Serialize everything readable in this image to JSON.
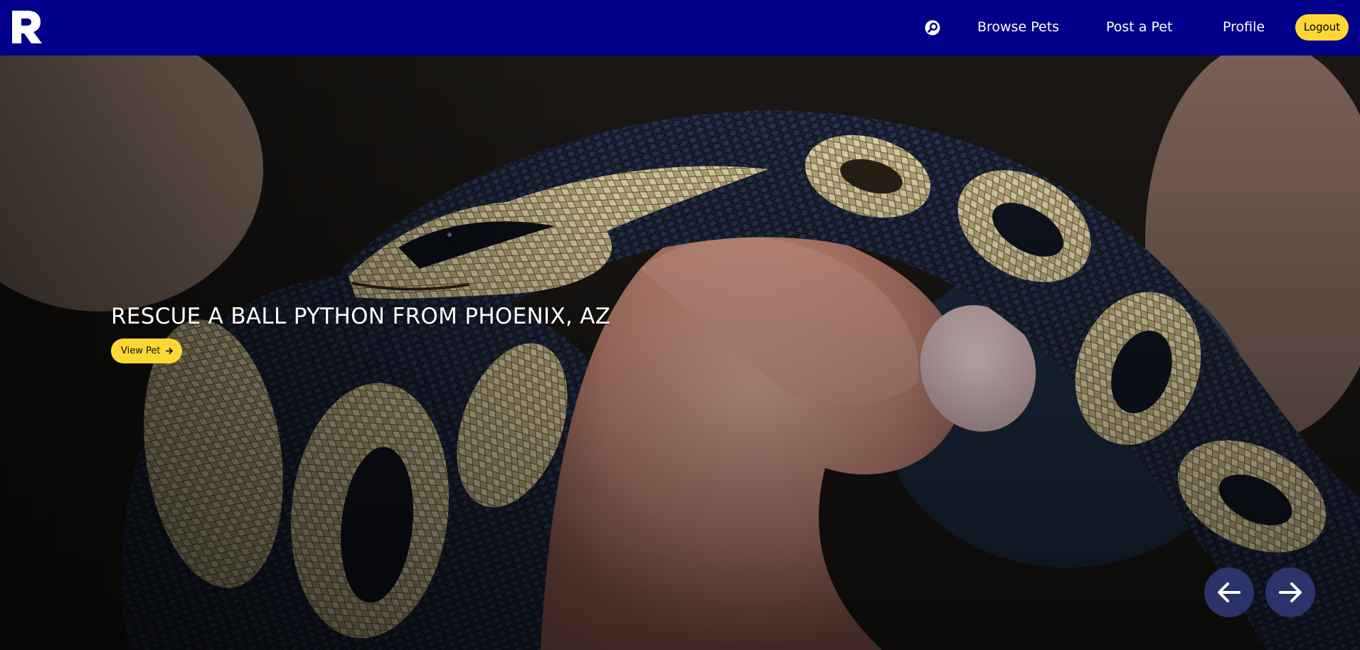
{
  "brand": {
    "logo_letter": "R",
    "colors": {
      "navbar": "#00008a",
      "accent": "#fdd835",
      "carousel_button": "#303a78"
    }
  },
  "nav": {
    "search_icon": "search-icon",
    "links": [
      "Browse Pets",
      "Post a Pet",
      "Profile"
    ],
    "logout_label": "Logout"
  },
  "hero": {
    "image_description": "ball-python-on-hand",
    "caption": "RESCUE A BALL PYTHON FROM PHOENIX, AZ",
    "cta_label": "View Pet",
    "cta_icon": "arrow-right-icon",
    "prev_icon": "arrow-left-icon",
    "next_icon": "arrow-right-icon"
  }
}
